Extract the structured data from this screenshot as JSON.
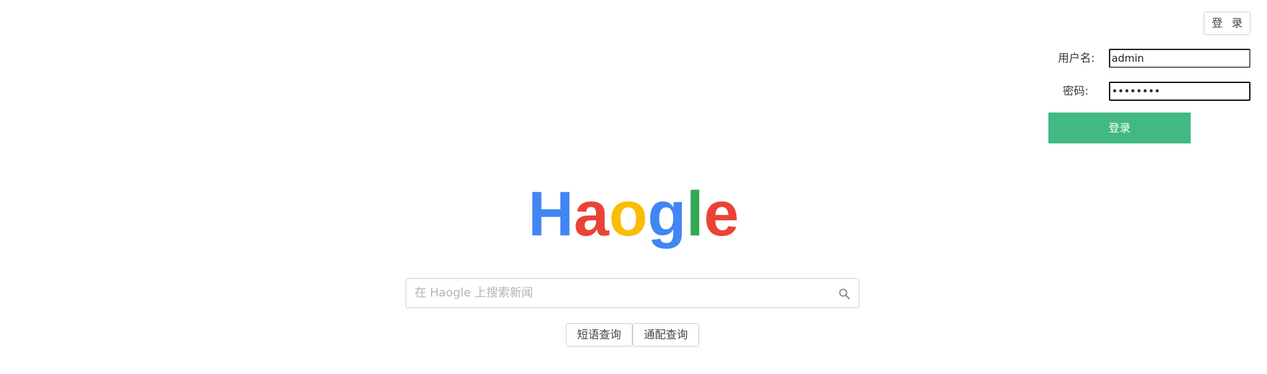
{
  "header": {
    "login_button": "登 录"
  },
  "login_form": {
    "username_label": "用户名:",
    "username_value": "admin",
    "password_label": "密码:",
    "password_value": "password",
    "submit_label": "登录",
    "submit_color": "#42b983"
  },
  "logo": {
    "letters": [
      {
        "char": "H",
        "color": "#4285F4"
      },
      {
        "char": "a",
        "color": "#EA4335"
      },
      {
        "char": "o",
        "color": "#FBBC05"
      },
      {
        "char": "g",
        "color": "#4285F4"
      },
      {
        "char": "l",
        "color": "#34A853"
      },
      {
        "char": "e",
        "color": "#EA4335"
      }
    ]
  },
  "search": {
    "placeholder": "在 Haogle 上搜索新闻",
    "value": "",
    "icon": "search-icon"
  },
  "query_buttons": {
    "phrase_label": "短语查询",
    "wildcard_label": "通配查询"
  }
}
